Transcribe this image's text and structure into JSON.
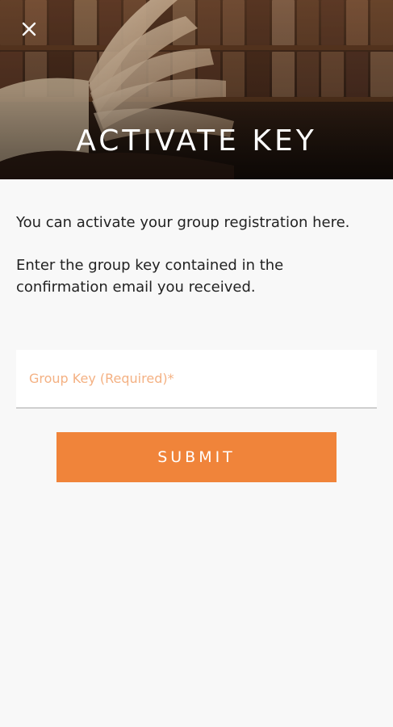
{
  "header": {
    "title": "ACTIVATE KEY",
    "close_icon": "close-icon"
  },
  "content": {
    "intro": "You can activate your group registration here.",
    "instructions": "Enter the group key contained in the confirmation email you received."
  },
  "form": {
    "group_key": {
      "placeholder": "Group Key (Required)*",
      "value": ""
    },
    "submit_label": "SUBMIT"
  },
  "colors": {
    "accent": "#f0843a",
    "placeholder": "#f4b183",
    "background": "#f8f8f8",
    "text": "#222222"
  }
}
